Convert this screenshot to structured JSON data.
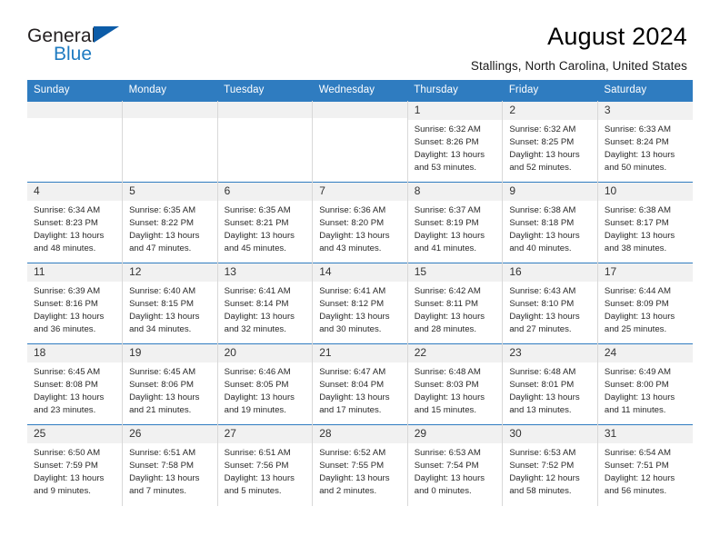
{
  "brand": {
    "name_part1": "General",
    "name_part2": "Blue",
    "accent_color": "#1f7bc1",
    "triangle_color": "#0c5ca8",
    "triangle_icon": "brand-triangle-icon"
  },
  "header": {
    "title": "August 2024",
    "subtitle": "Stallings, North Carolina, United States"
  },
  "calendar": {
    "header_bg": "#2f7cc0",
    "daynum_bg": "#f1f1f1",
    "weekday_labels": [
      "Sunday",
      "Monday",
      "Tuesday",
      "Wednesday",
      "Thursday",
      "Friday",
      "Saturday"
    ],
    "weeks": [
      [
        {
          "day": "",
          "empty": true
        },
        {
          "day": "",
          "empty": true
        },
        {
          "day": "",
          "empty": true
        },
        {
          "day": "",
          "empty": true
        },
        {
          "day": "1",
          "sunrise": "Sunrise: 6:32 AM",
          "sunset": "Sunset: 8:26 PM",
          "daylight1": "Daylight: 13 hours",
          "daylight2": "and 53 minutes."
        },
        {
          "day": "2",
          "sunrise": "Sunrise: 6:32 AM",
          "sunset": "Sunset: 8:25 PM",
          "daylight1": "Daylight: 13 hours",
          "daylight2": "and 52 minutes."
        },
        {
          "day": "3",
          "sunrise": "Sunrise: 6:33 AM",
          "sunset": "Sunset: 8:24 PM",
          "daylight1": "Daylight: 13 hours",
          "daylight2": "and 50 minutes."
        }
      ],
      [
        {
          "day": "4",
          "sunrise": "Sunrise: 6:34 AM",
          "sunset": "Sunset: 8:23 PM",
          "daylight1": "Daylight: 13 hours",
          "daylight2": "and 48 minutes."
        },
        {
          "day": "5",
          "sunrise": "Sunrise: 6:35 AM",
          "sunset": "Sunset: 8:22 PM",
          "daylight1": "Daylight: 13 hours",
          "daylight2": "and 47 minutes."
        },
        {
          "day": "6",
          "sunrise": "Sunrise: 6:35 AM",
          "sunset": "Sunset: 8:21 PM",
          "daylight1": "Daylight: 13 hours",
          "daylight2": "and 45 minutes."
        },
        {
          "day": "7",
          "sunrise": "Sunrise: 6:36 AM",
          "sunset": "Sunset: 8:20 PM",
          "daylight1": "Daylight: 13 hours",
          "daylight2": "and 43 minutes."
        },
        {
          "day": "8",
          "sunrise": "Sunrise: 6:37 AM",
          "sunset": "Sunset: 8:19 PM",
          "daylight1": "Daylight: 13 hours",
          "daylight2": "and 41 minutes."
        },
        {
          "day": "9",
          "sunrise": "Sunrise: 6:38 AM",
          "sunset": "Sunset: 8:18 PM",
          "daylight1": "Daylight: 13 hours",
          "daylight2": "and 40 minutes."
        },
        {
          "day": "10",
          "sunrise": "Sunrise: 6:38 AM",
          "sunset": "Sunset: 8:17 PM",
          "daylight1": "Daylight: 13 hours",
          "daylight2": "and 38 minutes."
        }
      ],
      [
        {
          "day": "11",
          "sunrise": "Sunrise: 6:39 AM",
          "sunset": "Sunset: 8:16 PM",
          "daylight1": "Daylight: 13 hours",
          "daylight2": "and 36 minutes."
        },
        {
          "day": "12",
          "sunrise": "Sunrise: 6:40 AM",
          "sunset": "Sunset: 8:15 PM",
          "daylight1": "Daylight: 13 hours",
          "daylight2": "and 34 minutes."
        },
        {
          "day": "13",
          "sunrise": "Sunrise: 6:41 AM",
          "sunset": "Sunset: 8:14 PM",
          "daylight1": "Daylight: 13 hours",
          "daylight2": "and 32 minutes."
        },
        {
          "day": "14",
          "sunrise": "Sunrise: 6:41 AM",
          "sunset": "Sunset: 8:12 PM",
          "daylight1": "Daylight: 13 hours",
          "daylight2": "and 30 minutes."
        },
        {
          "day": "15",
          "sunrise": "Sunrise: 6:42 AM",
          "sunset": "Sunset: 8:11 PM",
          "daylight1": "Daylight: 13 hours",
          "daylight2": "and 28 minutes."
        },
        {
          "day": "16",
          "sunrise": "Sunrise: 6:43 AM",
          "sunset": "Sunset: 8:10 PM",
          "daylight1": "Daylight: 13 hours",
          "daylight2": "and 27 minutes."
        },
        {
          "day": "17",
          "sunrise": "Sunrise: 6:44 AM",
          "sunset": "Sunset: 8:09 PM",
          "daylight1": "Daylight: 13 hours",
          "daylight2": "and 25 minutes."
        }
      ],
      [
        {
          "day": "18",
          "sunrise": "Sunrise: 6:45 AM",
          "sunset": "Sunset: 8:08 PM",
          "daylight1": "Daylight: 13 hours",
          "daylight2": "and 23 minutes."
        },
        {
          "day": "19",
          "sunrise": "Sunrise: 6:45 AM",
          "sunset": "Sunset: 8:06 PM",
          "daylight1": "Daylight: 13 hours",
          "daylight2": "and 21 minutes."
        },
        {
          "day": "20",
          "sunrise": "Sunrise: 6:46 AM",
          "sunset": "Sunset: 8:05 PM",
          "daylight1": "Daylight: 13 hours",
          "daylight2": "and 19 minutes."
        },
        {
          "day": "21",
          "sunrise": "Sunrise: 6:47 AM",
          "sunset": "Sunset: 8:04 PM",
          "daylight1": "Daylight: 13 hours",
          "daylight2": "and 17 minutes."
        },
        {
          "day": "22",
          "sunrise": "Sunrise: 6:48 AM",
          "sunset": "Sunset: 8:03 PM",
          "daylight1": "Daylight: 13 hours",
          "daylight2": "and 15 minutes."
        },
        {
          "day": "23",
          "sunrise": "Sunrise: 6:48 AM",
          "sunset": "Sunset: 8:01 PM",
          "daylight1": "Daylight: 13 hours",
          "daylight2": "and 13 minutes."
        },
        {
          "day": "24",
          "sunrise": "Sunrise: 6:49 AM",
          "sunset": "Sunset: 8:00 PM",
          "daylight1": "Daylight: 13 hours",
          "daylight2": "and 11 minutes."
        }
      ],
      [
        {
          "day": "25",
          "sunrise": "Sunrise: 6:50 AM",
          "sunset": "Sunset: 7:59 PM",
          "daylight1": "Daylight: 13 hours",
          "daylight2": "and 9 minutes."
        },
        {
          "day": "26",
          "sunrise": "Sunrise: 6:51 AM",
          "sunset": "Sunset: 7:58 PM",
          "daylight1": "Daylight: 13 hours",
          "daylight2": "and 7 minutes."
        },
        {
          "day": "27",
          "sunrise": "Sunrise: 6:51 AM",
          "sunset": "Sunset: 7:56 PM",
          "daylight1": "Daylight: 13 hours",
          "daylight2": "and 5 minutes."
        },
        {
          "day": "28",
          "sunrise": "Sunrise: 6:52 AM",
          "sunset": "Sunset: 7:55 PM",
          "daylight1": "Daylight: 13 hours",
          "daylight2": "and 2 minutes."
        },
        {
          "day": "29",
          "sunrise": "Sunrise: 6:53 AM",
          "sunset": "Sunset: 7:54 PM",
          "daylight1": "Daylight: 13 hours",
          "daylight2": "and 0 minutes."
        },
        {
          "day": "30",
          "sunrise": "Sunrise: 6:53 AM",
          "sunset": "Sunset: 7:52 PM",
          "daylight1": "Daylight: 12 hours",
          "daylight2": "and 58 minutes."
        },
        {
          "day": "31",
          "sunrise": "Sunrise: 6:54 AM",
          "sunset": "Sunset: 7:51 PM",
          "daylight1": "Daylight: 12 hours",
          "daylight2": "and 56 minutes."
        }
      ]
    ]
  }
}
